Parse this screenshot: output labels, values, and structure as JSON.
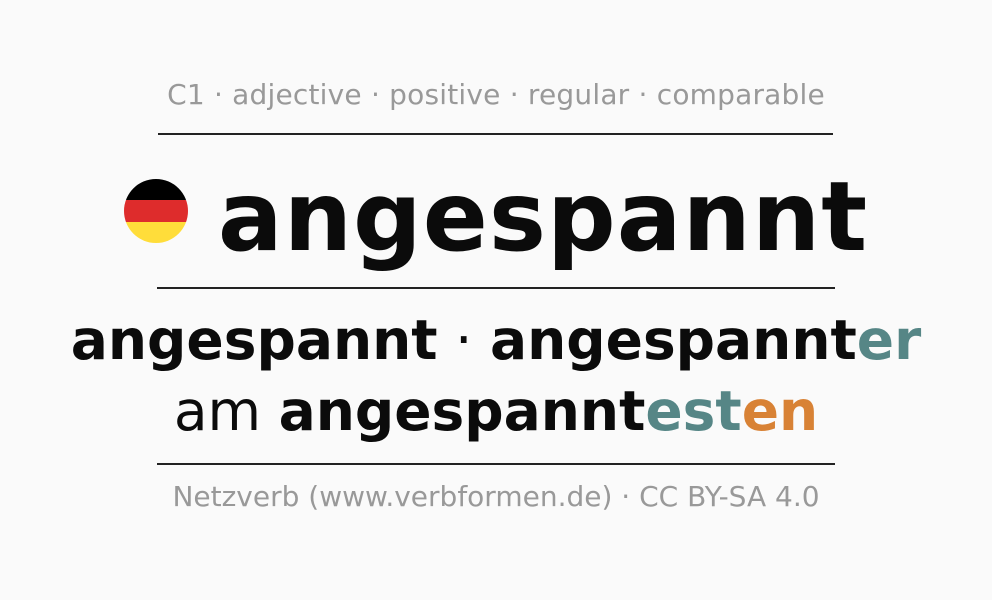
{
  "meta": {
    "level": "C1",
    "separator": " · ",
    "items": [
      "adjective",
      "positive",
      "regular",
      "comparable"
    ]
  },
  "headword": "angespannt",
  "flag": {
    "icon": "germany-flag-icon",
    "colors": [
      "#000000",
      "#de2c2c",
      "#ffdd3a"
    ]
  },
  "forms": {
    "positive": "angespannt",
    "dot": "·",
    "comparative": {
      "stem": "angespannt",
      "ending": "er"
    },
    "superlative": {
      "particle": "am",
      "stem": "angespannt",
      "ending1": "est",
      "ending2": "en"
    }
  },
  "colors": {
    "ending_teal": "#568686",
    "ending_orange": "#d88235",
    "meta_gray": "#999999"
  },
  "footer": "Netzverb (www.verbformen.de) · CC BY-SA 4.0"
}
